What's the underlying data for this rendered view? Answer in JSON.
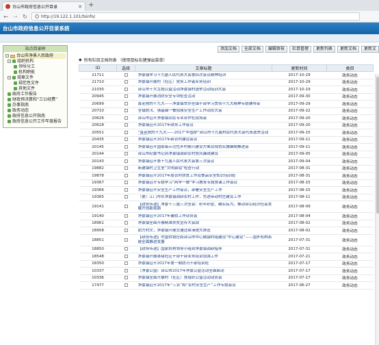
{
  "browser": {
    "tab_title": "台山市政府信息公开目录",
    "url": "http://19.122.1.101/tsinfo/"
  },
  "app": {
    "title": "台山市政府信息公开目录系统"
  },
  "sidebar": {
    "title": "站点目录树",
    "tree": [
      {
        "label": "台山市净景人民政府",
        "level": 0,
        "toggle": "−",
        "icon": "folder-icon"
      },
      {
        "label": "组织机构",
        "level": 1,
        "toggle": "−",
        "icon": "node-icon"
      },
      {
        "label": "领导分工",
        "level": 2,
        "toggle": "",
        "icon": "node-icon"
      },
      {
        "label": "机构职能",
        "level": 2,
        "toggle": "",
        "icon": "node-icon"
      },
      {
        "label": "规章文件",
        "level": 1,
        "toggle": "−",
        "icon": "node-icon"
      },
      {
        "label": "规范性文件",
        "level": 2,
        "toggle": "",
        "icon": "node-icon"
      },
      {
        "label": "其他文件",
        "level": 2,
        "toggle": "",
        "icon": "node-icon"
      },
      {
        "label": "政府工作报告",
        "level": 1,
        "toggle": "",
        "icon": "node-icon"
      },
      {
        "label": "财政预决算和“三公经费”",
        "level": 1,
        "toggle": "",
        "icon": "node-icon"
      },
      {
        "label": "办事指南",
        "level": 1,
        "toggle": "",
        "icon": "node-icon"
      },
      {
        "label": "政务动态",
        "level": 1,
        "toggle": "",
        "icon": "node-icon"
      },
      {
        "label": "政府信息公开指南",
        "level": 1,
        "toggle": "",
        "icon": "node-icon"
      },
      {
        "label": "政府信息公开工作年度报告",
        "level": 1,
        "toggle": "",
        "icon": "node-icon"
      }
    ]
  },
  "toolbar": {
    "buttons": [
      "添加文档",
      "全部文档",
      "编辑审核",
      "栏目管理",
      "更新列表",
      "更新文档",
      "更新文"
    ]
  },
  "list": {
    "title": "所有栏目文档列表 （使用鼠标右键弹出菜单）",
    "columns": [
      "ID",
      "选择",
      "文章标题",
      "更新时间",
      "类目"
    ],
    "rows": [
      {
        "id": "21711",
        "title": "净景镇学习十九届人民代表大会第四次会议精神培训",
        "time": "2017-10-29",
        "cat": "政务动态"
      },
      {
        "id": "21710",
        "title": "净景镇开展村（社区）党务工作者业务培训",
        "time": "2017-10-29",
        "cat": "政务动态"
      },
      {
        "id": "21030",
        "title": "台山市十大主题公益活动净景镇村选举活动培训大会",
        "time": "2017-10-19",
        "cat": "政务动态"
      },
      {
        "id": "20945",
        "title": "净景镇开展消防安全专项检查活动",
        "time": "2017-09-30",
        "cat": "政务动态"
      },
      {
        "id": "20699",
        "title": "喜迎党的十九大——净景镇举办全镇干部学习贯彻十九大精神专题辅导会",
        "time": "2017-09-29",
        "cat": "政务动态"
      },
      {
        "id": "20710",
        "title": "全镇防汛、强基础一餐加强安全生产工作动员大会",
        "time": "2017-09-22",
        "cat": "政务动态"
      },
      {
        "id": "20626",
        "title": "台山市召开净景镇农民专业合作社现场会",
        "time": "2017-09-20",
        "cat": "政务动态"
      },
      {
        "id": "20628",
        "title": "净景镇召开2017年政务工作会议",
        "time": "2017-09-20",
        "cat": "政务动态"
      },
      {
        "id": "20551",
        "title": "“喜迎党的十九大——2017“中国梦”台山市十九届村民代表大会代表选举活动进行中”",
        "time": "2017-09-15",
        "cat": "政务动态"
      },
      {
        "id": "20435",
        "title": "净景镇召开2017年新农村建设会议",
        "time": "2017-09-11",
        "cat": "政务动态"
      },
      {
        "id": "20145",
        "title": "净景镇召开国家级示范性乡村振兴建设方案及规划实施编制推进会",
        "time": "2017-09-11",
        "cat": "政务动态"
      },
      {
        "id": "20144",
        "title": "台山市纪委书记到净景镇调研农村党风廉政建设",
        "time": "2017-09-05",
        "cat": "政务动态"
      },
      {
        "id": "20143",
        "title": "净景镇召开第十九届人民代表大会第三次会议",
        "time": "2017-09-04",
        "cat": "政务动态"
      },
      {
        "id": "19882",
        "title": "新建镇村卫生室“文明驿站”检查行动",
        "time": "2017-08-31",
        "cat": "政务动态"
      },
      {
        "id": "19878",
        "title": "净景镇召开2017年度农村扶贫工作及食品安全知识培训班",
        "time": "2017-08-31",
        "cat": "政务动态"
      },
      {
        "id": "19367",
        "title": "净景镇召开专题学习“两学一做”学习教育专题党课工作会议",
        "time": "2017-08-15",
        "cat": "政务动态"
      },
      {
        "id": "19366",
        "title": "净景镇召开安全生产工作会议，部署安全生产工作",
        "time": "2017-08-15",
        "cat": "政务动态"
      },
      {
        "id": "19365",
        "title": "（第）江门市长净景镇调研农村工作，先进带动村庄建设工作",
        "time": "2017-08-11",
        "cat": "政务动态"
      },
      {
        "id": "19141",
        "title": "【政务传递】净景十三届三次全会：织牢织密、确实有为，推动台山经济社会发展开创新局面",
        "time": "2017-08-09",
        "cat": "政务动态",
        "tall": true
      },
      {
        "id": "19140",
        "title": "净景镇召开2017年暑假工作动员会",
        "time": "2017-08-04",
        "cat": "政务动态"
      },
      {
        "id": "18961",
        "title": "净景镇全面开展精准扶贫宣传大会战",
        "time": "2017-08-02",
        "cat": "政务动态"
      },
      {
        "id": "18958",
        "title": "助力村文，净景镇开展交通违章清理大排查",
        "time": "2017-08-02",
        "cat": "政务动态"
      },
      {
        "id": "18851",
        "title": "【政务传递】中国供销社和台山市中心城镇村组建设“中心建设”——国外机构系统全面推进发展",
        "time": "2017-07-31",
        "cat": "政务动态",
        "tall": true
      },
      {
        "id": "18850",
        "title": "【政务传递】国家机构领导小组到净景镇调研指导",
        "time": "2017-07-31",
        "cat": "政务动态"
      },
      {
        "id": "18548",
        "title": "净景镇开展县级社区干部干部业务培训加强工作",
        "time": "2017-07-21",
        "cat": "政务动态"
      },
      {
        "id": "18350",
        "title": "净景镇召开2017年第一期防汛干部培训班",
        "time": "2017-07-17",
        "cat": "政务动态"
      },
      {
        "id": "10337",
        "title": "（净景公益）台山市2017年净景公益活动全面启动",
        "time": "2017-07-17",
        "cat": "政务动态"
      },
      {
        "id": "10336",
        "title": "净景镇全面开展村（社区）党组织公益活动动员会",
        "time": "2017-07-17",
        "cat": "政务动态"
      },
      {
        "id": "17477",
        "title": "净景镇召开2017年“三农”和“农村安全生产”工作专题会议",
        "time": "2017-06-27",
        "cat": "政务动态"
      }
    ]
  }
}
